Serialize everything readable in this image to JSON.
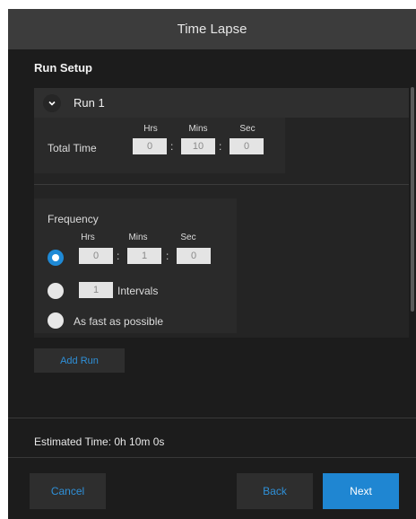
{
  "dialog": {
    "title": "Time Lapse",
    "section_title": "Run Setup"
  },
  "run": {
    "label": "Run 1",
    "expanded": true,
    "total_time": {
      "label": "Total Time",
      "unit_labels": {
        "hrs": "Hrs",
        "mins": "Mins",
        "sec": "Sec"
      },
      "hrs": "0",
      "mins": "10",
      "sec": "0"
    },
    "frequency": {
      "label": "Frequency",
      "unit_labels": {
        "hrs": "Hrs",
        "mins": "Mins",
        "sec": "Sec"
      },
      "hrs": "0",
      "mins": "1",
      "sec": "0",
      "selected_option": "interval-time",
      "intervals_value": "1",
      "intervals_label": "Intervals",
      "fast_label": "As fast as possible"
    }
  },
  "add_run_label": "Add Run",
  "estimated_time": "Estimated Time: 0h 10m 0s",
  "footer": {
    "cancel_label": "Cancel",
    "back_label": "Back",
    "next_label": "Next"
  },
  "colors": {
    "accent": "#1f86d2",
    "link_blue": "#2f90d8",
    "background": "#1c1c1c",
    "titlebar": "#3c3c3c"
  },
  "icons": {
    "expand": "chevron-down-icon"
  }
}
